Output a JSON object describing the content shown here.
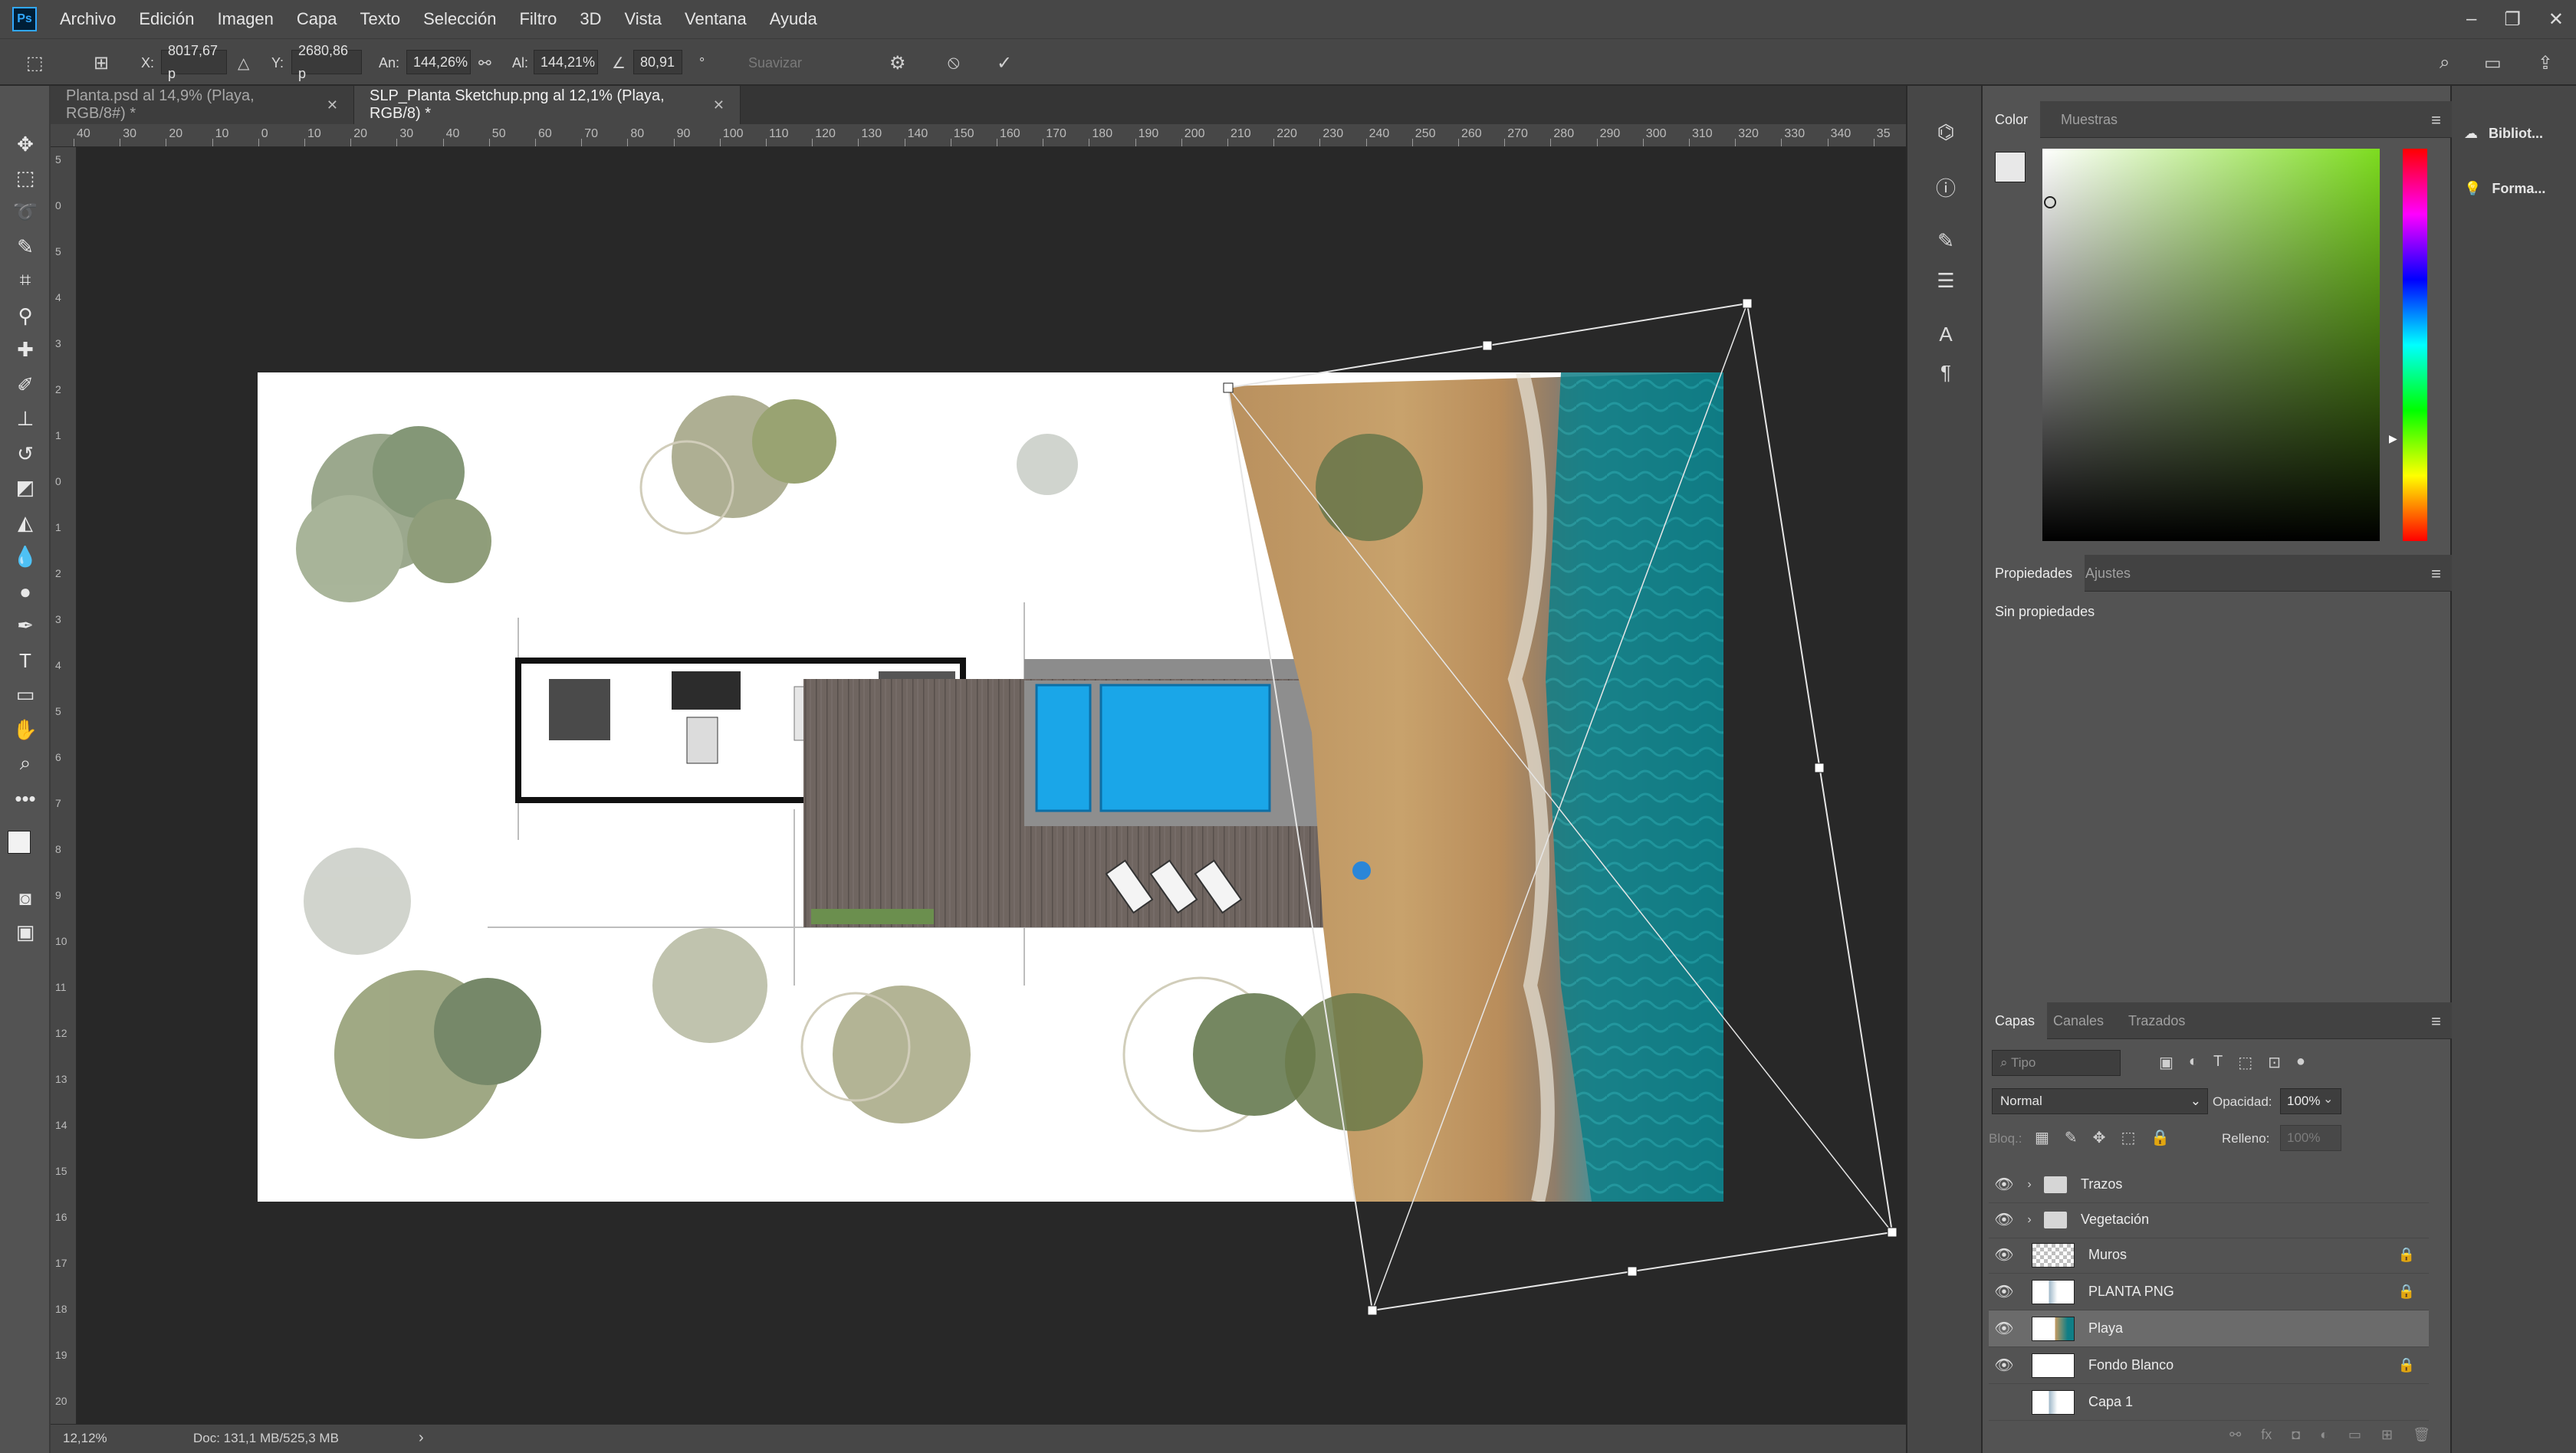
{
  "app": {
    "logo": "Ps"
  },
  "menu": [
    "Archivo",
    "Edición",
    "Imagen",
    "Capa",
    "Texto",
    "Selección",
    "Filtro",
    "3D",
    "Vista",
    "Ventana",
    "Ayuda"
  ],
  "options": {
    "x_label": "X:",
    "x_value": "8017,67 p",
    "y_label": "Y:",
    "y_value": "2680,86 p",
    "w_label": "An:",
    "w_value": "144,26%",
    "h_label": "Al:",
    "h_value": "144,21%",
    "angle_value": "80,91",
    "angle_unit": "°",
    "smooth_label": "Suavizar"
  },
  "tabs": [
    {
      "label": "Planta.psd al 14,9% (Playa, RGB/8#) *",
      "active": false
    },
    {
      "label": "SLP_Planta Sketchup.png al 12,1% (Playa, RGB/8) *",
      "active": true
    }
  ],
  "ruler_top": [
    "40",
    "30",
    "20",
    "10",
    "0",
    "10",
    "20",
    "30",
    "40",
    "50",
    "60",
    "70",
    "80",
    "90",
    "100",
    "110",
    "120",
    "130",
    "140",
    "150",
    "160",
    "170",
    "180",
    "190",
    "200",
    "210",
    "220",
    "230",
    "240",
    "250",
    "260",
    "270",
    "280",
    "290",
    "300",
    "310",
    "320",
    "330",
    "340",
    "35"
  ],
  "ruler_left": [
    "5",
    "0",
    "5",
    "4",
    "3",
    "2",
    "1",
    "0",
    "1",
    "2",
    "3",
    "4",
    "5",
    "6",
    "7",
    "8",
    "9",
    "10",
    "11",
    "12",
    "13",
    "14",
    "15",
    "16",
    "17",
    "18",
    "19",
    "20"
  ],
  "status": {
    "zoom": "12,12%",
    "doc": "Doc: 131,1 MB/525,3 MB"
  },
  "color_panel": {
    "tabs": [
      "Color",
      "Muestras"
    ],
    "hue_color": "#7ddc1f"
  },
  "properties_panel": {
    "tabs": [
      "Propiedades",
      "Ajustes"
    ],
    "message": "Sin propiedades"
  },
  "layers_panel": {
    "tabs": [
      "Capas",
      "Canales",
      "Trazados"
    ],
    "filter_placeholder": "Tipo",
    "blend_mode": "Normal",
    "opacity_label": "Opacidad:",
    "opacity_value": "100%",
    "lock_label": "Bloq.:",
    "fill_label": "Relleno:",
    "fill_value": "100%",
    "layers": [
      {
        "name": "Trazos",
        "kind": "group",
        "visible": true,
        "locked": false,
        "selected": false
      },
      {
        "name": "Vegetación",
        "kind": "group",
        "visible": true,
        "locked": false,
        "selected": false
      },
      {
        "name": "Muros",
        "kind": "layer",
        "visible": true,
        "locked": true,
        "selected": false
      },
      {
        "name": "PLANTA PNG",
        "kind": "layer",
        "visible": true,
        "locked": true,
        "selected": false
      },
      {
        "name": "Playa",
        "kind": "smart",
        "visible": true,
        "locked": false,
        "selected": true
      },
      {
        "name": "Fondo Blanco",
        "kind": "white",
        "visible": true,
        "locked": true,
        "selected": false
      },
      {
        "name": "Capa 1",
        "kind": "layer",
        "visible": false,
        "locked": false,
        "selected": false
      }
    ]
  },
  "far_right": {
    "libraries": "Bibliot...",
    "shapes": "Forma..."
  },
  "colors": {
    "sand": "#c49a62",
    "ocean": "#0f7e86",
    "pool": "#1aa6e8",
    "deck": "#6d635d",
    "tree": "#7f8a5c"
  }
}
